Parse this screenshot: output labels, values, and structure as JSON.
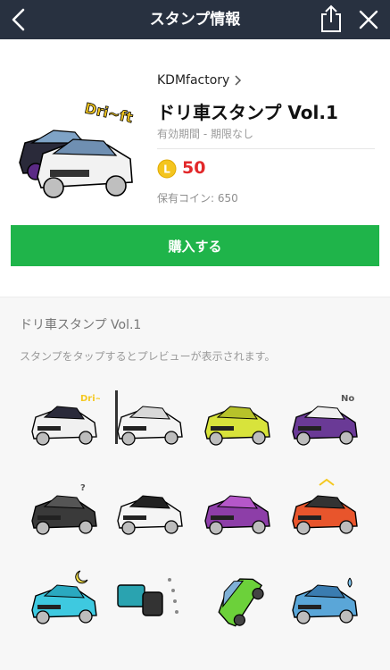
{
  "header": {
    "title": "スタンプ情報",
    "back_icon": "chevron-left-icon",
    "share_icon": "share-icon",
    "close_icon": "close-icon",
    "background": "#283140"
  },
  "product": {
    "vendor": "KDMfactory",
    "name": "ドリ車スタンプ Vol.1",
    "period": "有効期間 - 期限なし",
    "coin_icon": "line-coin-icon",
    "coin_letter": "L",
    "price": "50",
    "owned_coins": "保有コイン: 650",
    "buy_label": "購入する",
    "thumb_text": "Dri~ft",
    "accent": "#1fb44a",
    "price_color": "#e2282a"
  },
  "preview": {
    "set_title": "ドリ車スタンプ Vol.1",
    "hint": "スタンプをタップするとプレビューが表示されます。",
    "stickers": [
      {
        "name": "drift-cars-sticker",
        "caption": "Dri~ft"
      },
      {
        "name": "white-car-flag-sticker",
        "caption": ""
      },
      {
        "name": "yellow-car-sticker",
        "caption": ""
      },
      {
        "name": "purple-car-rear-sticker",
        "caption": "No"
      },
      {
        "name": "black-car-question-sticker",
        "caption": "?"
      },
      {
        "name": "white-car-sparkle-sticker",
        "caption": ""
      },
      {
        "name": "purple-car-sigh-sticker",
        "caption": ""
      },
      {
        "name": "orange-car-hood-open-sticker",
        "caption": ""
      },
      {
        "name": "blue-car-moon-sticker",
        "caption": ""
      },
      {
        "name": "teal-parts-sticker",
        "caption": ""
      },
      {
        "name": "green-car-spin-sticker",
        "caption": ""
      },
      {
        "name": "blue-car-sweat-sticker",
        "caption": ""
      }
    ]
  }
}
